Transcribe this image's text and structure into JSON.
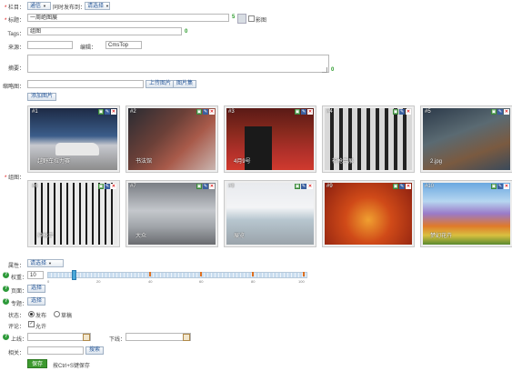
{
  "column": {
    "label": "栏目：",
    "value": "通信",
    "also_label": "同时发布到：",
    "also_value": "请选择"
  },
  "title": {
    "label": "标题：",
    "value": "一周绝图展",
    "count": "5",
    "bold_label": "影图"
  },
  "tags": {
    "label": "Tags：",
    "value": "组图",
    "count": "0"
  },
  "source": {
    "label": "来源：",
    "value": "",
    "editor_label": "编辑：",
    "editor_value": "CmsTop"
  },
  "summary": {
    "label": "摘要：",
    "value": "",
    "count": "0"
  },
  "thumb": {
    "label": "缩略图：",
    "upload": "上传图片",
    "library": "图片集"
  },
  "add_image": "添加图片",
  "gallery_label": "组图：",
  "images": [
    {
      "num": "#1",
      "caption": "越野车拉力赛"
    },
    {
      "num": "#2",
      "caption": "书法馆"
    },
    {
      "num": "#3",
      "caption": "4月9号"
    },
    {
      "num": "#4",
      "caption": "神枪手展"
    },
    {
      "num": "#5",
      "caption": "2.jpg"
    },
    {
      "num": "#6",
      "caption": "神枪手"
    },
    {
      "num": "#7",
      "caption": "大众"
    },
    {
      "num": "#8",
      "caption": "展览"
    },
    {
      "num": "#9",
      "caption": ""
    },
    {
      "num": "#10",
      "caption": "梦幻花卉"
    }
  ],
  "attr": {
    "label": "属性：",
    "value": "请选择"
  },
  "weight": {
    "label": "权重：",
    "value": "10",
    "ticks": [
      "0",
      "20",
      "40",
      "60",
      "80",
      "100"
    ],
    "level": 10
  },
  "page": {
    "label": "页面：",
    "button": "选择"
  },
  "topic": {
    "label": "专题：",
    "button": "选择"
  },
  "status": {
    "label": "状态：",
    "opt1": "发布",
    "opt2": "草稿"
  },
  "comment": {
    "label": "评论：",
    "opt": "允许"
  },
  "online": {
    "label": "上线：",
    "value": "",
    "offline_label": "下线：",
    "offline_value": ""
  },
  "related": {
    "label": "相关：",
    "value": "",
    "button": "搜索"
  },
  "save": {
    "button": "保存",
    "hint": "按Ctrl+S键保存"
  },
  "colors": {
    "accent": "#2a5a9a",
    "save_green": "#3d9a2f",
    "required": "#d00000",
    "help": "#2e9a3a"
  }
}
